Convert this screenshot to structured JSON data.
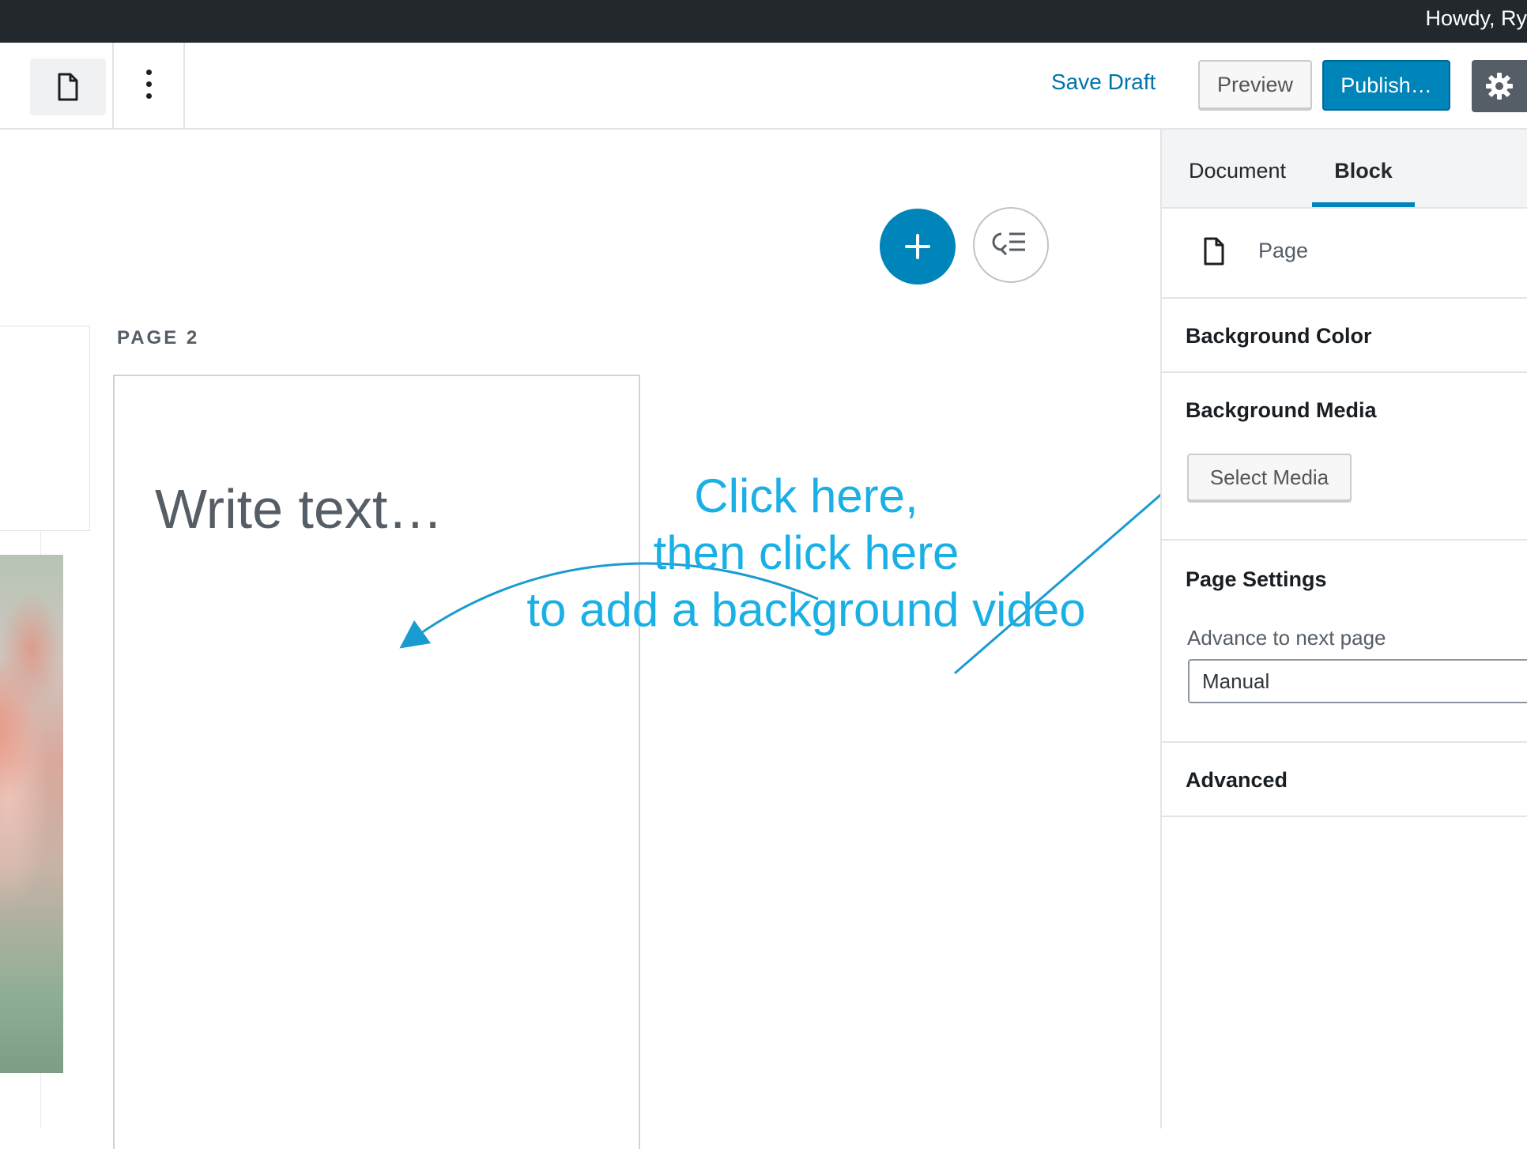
{
  "admin_bar": {
    "greeting": "Howdy, Ry"
  },
  "header": {
    "document_icon": "page-icon",
    "more_icon": "more-vertical-icon",
    "save_draft": "Save Draft",
    "preview": "Preview",
    "publish": "Publish…",
    "settings_icon": "gear-icon"
  },
  "canvas": {
    "inserter_icon": "plus-icon",
    "navigation_icon": "block-navigation-icon",
    "page_label": "PAGE 2",
    "placeholder": "Write text…"
  },
  "annotation": {
    "line1": "Click here,",
    "line2": "then click here",
    "line3": "to add a background video",
    "color": "#1ab0e6"
  },
  "sidebar": {
    "tabs": [
      "Document",
      "Block"
    ],
    "active_tab": "Block",
    "block": {
      "icon": "page-icon",
      "name": "Page"
    },
    "panels": {
      "background_color": "Background Color",
      "background_media": "Background Media",
      "select_media": "Select Media",
      "page_settings": "Page Settings",
      "advance_label": "Advance to next page",
      "advance_value": "Manual",
      "advanced": "Advanced"
    }
  },
  "colors": {
    "admin_bar": "#23282d",
    "primary": "#0085ba",
    "link": "#0073aa"
  }
}
